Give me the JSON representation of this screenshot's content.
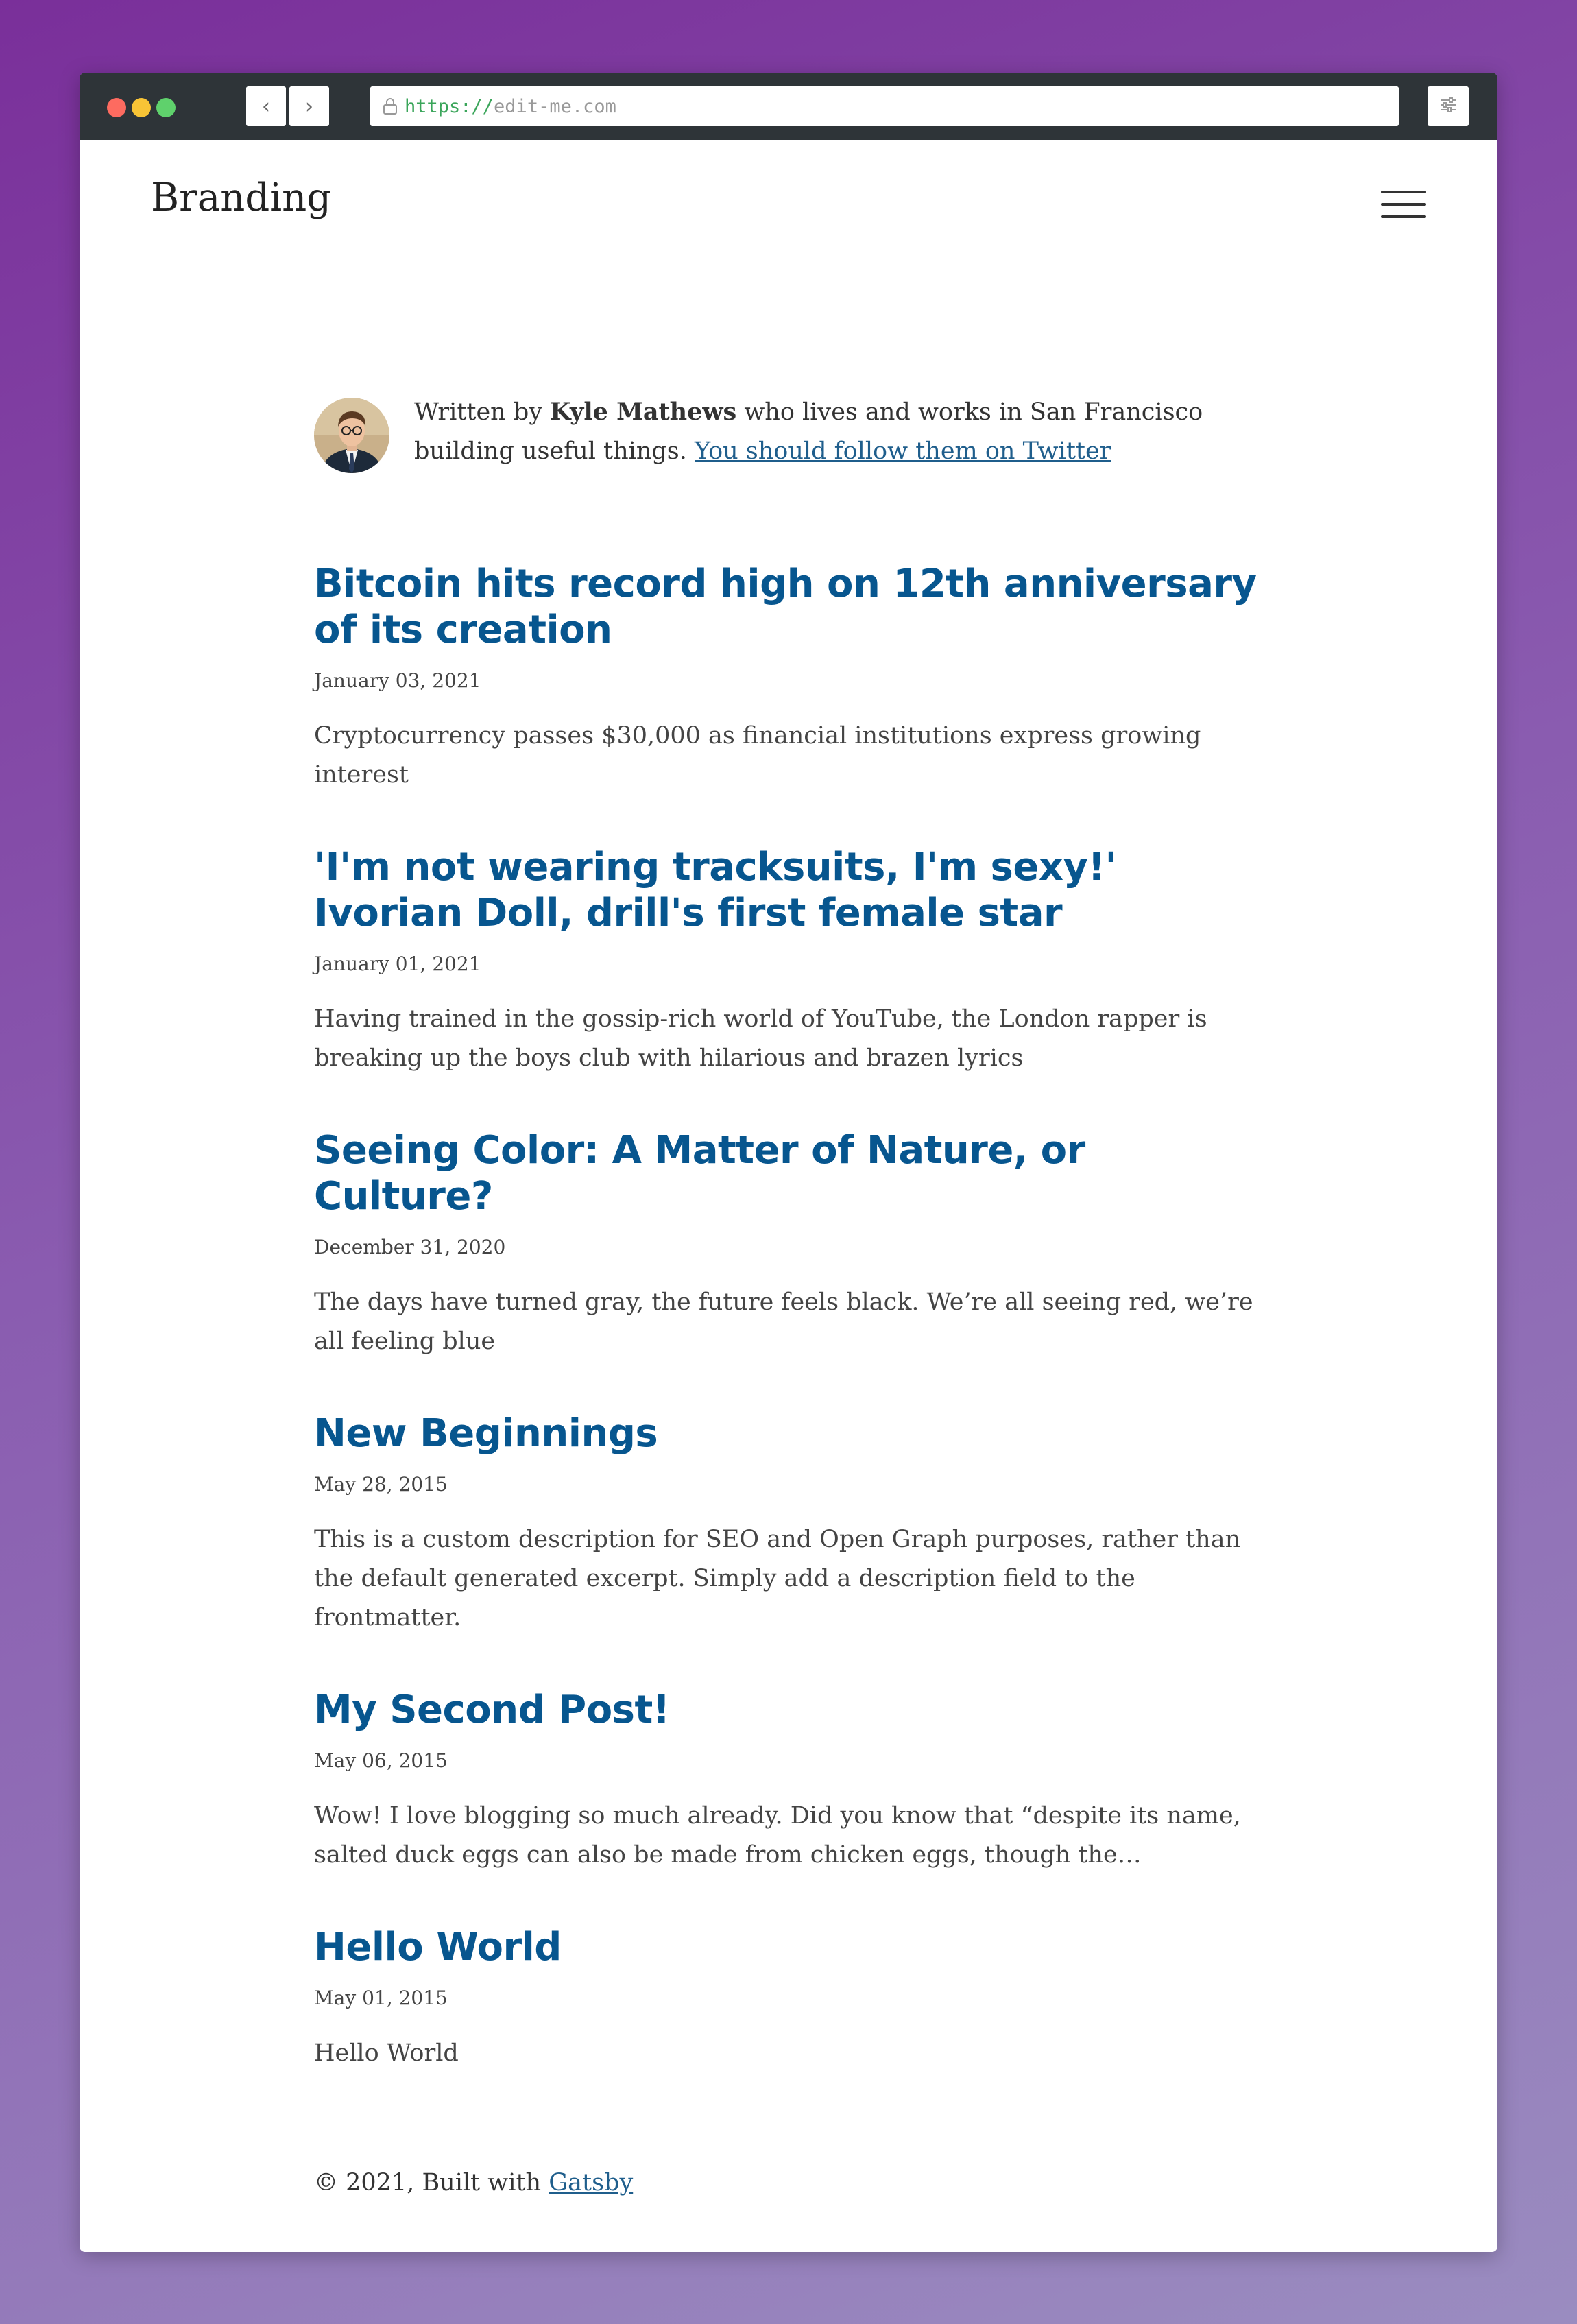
{
  "browser": {
    "url_scheme": "https://",
    "url_host": "edit-me.com",
    "back_label": "‹",
    "forward_label": "›"
  },
  "header": {
    "branding": "Branding"
  },
  "bio": {
    "prefix": "Written by ",
    "author": "Kyle Mathews",
    "suffix": " who lives and works in San Francisco building useful things. ",
    "link": "You should follow them on Twitter"
  },
  "posts": [
    {
      "title": "Bitcoin hits record high on 12th anniversary of its creation",
      "date": "January 03, 2021",
      "description": "Cryptocurrency passes $30,000 as financial institutions express growing interest"
    },
    {
      "title": "'I'm not wearing tracksuits, I'm sexy!' Ivorian Doll, drill's first female star",
      "date": "January 01, 2021",
      "description": "Having trained in the gossip-rich world of YouTube, the London rapper is breaking up the boys club with hilarious and brazen lyrics"
    },
    {
      "title": "Seeing Color: A Matter of Nature, or Culture?",
      "date": "December 31, 2020",
      "description": "The days have turned gray, the future feels black. We’re all seeing red, we’re all feeling blue"
    },
    {
      "title": "New Beginnings",
      "date": "May 28, 2015",
      "description": "This is a custom description for SEO and Open Graph purposes, rather than the default generated excerpt. Simply add a description field to the frontmatter."
    },
    {
      "title": "My Second Post!",
      "date": "May 06, 2015",
      "description": "Wow! I love blogging so much already. Did you know that “despite its name, salted duck eggs can also be made from chicken eggs, though the…"
    },
    {
      "title": "Hello World",
      "date": "May 01, 2015",
      "description": "Hello World"
    }
  ],
  "footer": {
    "prefix": "© 2021, Built with ",
    "link": "Gatsby"
  },
  "colors": {
    "title": "#07568f",
    "link": "#1f5e8c"
  }
}
